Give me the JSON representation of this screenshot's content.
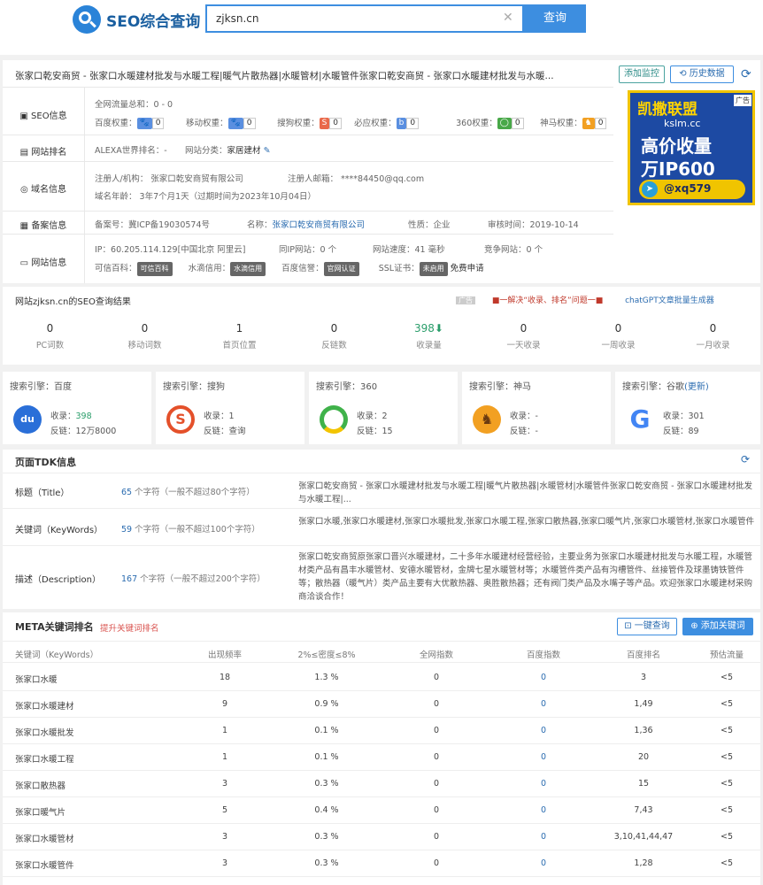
{
  "header": {
    "logo_text": "SEO综合查询",
    "search_value": "zjksn.cn",
    "search_button": "查询"
  },
  "site": {
    "title": "张家口乾安商贸 - 张家口水暖建材批发与水暖工程|暖气片散热器|水暖管材|水暖管件张家口乾安商贸 - 张家口水暖建材批发与水暖...",
    "add_monitor": "添加监控",
    "history": "历史数据",
    "rows": {
      "seo": {
        "label": "SEO信息",
        "total": "全网流量总和：0 - 0",
        "weights": [
          {
            "name": "百度权重：",
            "value": "0",
            "color": "#5a8fe0"
          },
          {
            "name": "移动权重：",
            "value": "0",
            "color": "#5a8fe0"
          },
          {
            "name": "搜狗权重：",
            "value": "0",
            "color": "#e9694a"
          },
          {
            "name": "必应权重：",
            "value": "0",
            "color": "#5a8fe0"
          },
          {
            "name": "360权重：",
            "value": "0",
            "color": "#48a848"
          },
          {
            "name": "神马权重：",
            "value": "0",
            "color": "#f2a022"
          }
        ]
      },
      "rank": {
        "label": "网站排名",
        "alexa": "ALEXA世界排名：-",
        "category_label": "网站分类：",
        "category_value": "家居建材"
      },
      "domain": {
        "label": "域名信息",
        "registrant": "注册人/机构：  张家口乾安商贸有限公司",
        "email": "注册人邮箱：  ****84450@qq.com",
        "age": "域名年龄：  3年7个月1天（过期时间为2023年10月04日）"
      },
      "icp": {
        "label": "备案信息",
        "number": "备案号：冀ICP备19030574号",
        "name_label": "名称：",
        "name_value": "张家口乾安商贸有限公司",
        "nature": "性质：企业",
        "date": "审核时间：2019-10-14"
      },
      "website": {
        "label": "网站信息",
        "ip": "IP：60.205.114.129[中国北京 阿里云]",
        "same_ip": "同IP网站：0 个",
        "speed": "网站速度：41 毫秒",
        "competitors": "竞争网站：0 个",
        "trust_label": "可信百科：",
        "trust_badge": "可信百科",
        "water_label": "水滴信用：",
        "water_badge": "水滴信用",
        "baidu_label": "百度信誉：",
        "baidu_badge": "官网认证",
        "ssl_label": "SSL证书：",
        "ssl_badge": "未启用",
        "ssl_apply": "免费申请"
      }
    }
  },
  "ad": {
    "brand": "凯撒联盟",
    "tag": "广告",
    "domain": "kslm.cc",
    "line1": "高价收量",
    "line2": "万IP600",
    "contact": "@xq579"
  },
  "results": {
    "title": "网站zjksn.cn的SEO查询结果",
    "tag": "广告",
    "promo1": "■一解决“收录、排名”问题一■",
    "promo2": "chatGPT文章批量生成器",
    "stats": [
      {
        "value": "0",
        "label": "PC词数"
      },
      {
        "value": "0",
        "label": "移动词数"
      },
      {
        "value": "1",
        "label": "首页位置"
      },
      {
        "value": "0",
        "label": "反链数"
      },
      {
        "value": "398⬇",
        "label": "收录量"
      },
      {
        "value": "0",
        "label": "一天收录"
      },
      {
        "value": "0",
        "label": "一周收录"
      },
      {
        "value": "0",
        "label": "一月收录"
      }
    ]
  },
  "engines": [
    {
      "title": "搜索引擎：百度",
      "index_label": "收录：",
      "index_value": "398",
      "links_label": "反链：",
      "links_value": "12万8000",
      "icon": "baidu-icon"
    },
    {
      "title": "搜索引擎：搜狗",
      "index_label": "收录：",
      "index_value": "1",
      "links_label": "反链：",
      "links_value": "查询",
      "icon": "sogou-icon"
    },
    {
      "title": "搜索引擎：360",
      "index_label": "收录：",
      "index_value": "2",
      "links_label": "反链：",
      "links_value": "15",
      "icon": "360-icon"
    },
    {
      "title": "搜索引擎：神马",
      "index_label": "收录：",
      "index_value": "-",
      "links_label": "反链：",
      "links_value": "-",
      "icon": "shenma-icon"
    },
    {
      "title": "搜索引擎：谷歌",
      "update": "(更新)",
      "index_label": "收录：",
      "index_value": "301",
      "links_label": "反链：",
      "links_value": "89",
      "icon": "google-icon"
    }
  ],
  "tdk": {
    "title": "页面TDK信息",
    "rows": [
      {
        "label": "标题（Title）",
        "count": "65",
        "count_text": " 个字符（一般不超过80个字符）",
        "content": "张家口乾安商贸 - 张家口水暖建材批发与水暖工程|暖气片散热器|水暖管材|水暖管件张家口乾安商贸 - 张家口水暖建材批发与水暖工程|..."
      },
      {
        "label": "关键词（KeyWords）",
        "count": "59",
        "count_text": " 个字符（一般不超过100个字符）",
        "content": "张家口水暖,张家口水暖建材,张家口水暖批发,张家口水暖工程,张家口散热器,张家口暖气片,张家口水暖管材,张家口水暖管件"
      },
      {
        "label": "描述（Description）",
        "count": "167",
        "count_text": " 个字符（一般不超过200个字符）",
        "content": "张家口乾安商贸原张家口晋兴水暖建材，二十多年水暖建材经营经验，主要业务为张家口水暖建材批发与水暖工程，水暖管材类产品有昌丰水暖管材、安德水暖管材，金牌七星水暖管材等；水暖管件类产品有沟槽管件、丝接管件及球墨铸铁管件等；散热器（暖气片）类产品主要有大优散热器、奥胜散热器；还有阀门类产品及水嘴子等产品。欢迎张家口水暖建材采购商洽谈合作！"
      }
    ]
  },
  "meta": {
    "title": "META关键词排名",
    "promote": "提升关键词排名",
    "one_click": "一键查询",
    "add_keyword": "添加关键词",
    "headers": [
      "关键词（KeyWords）",
      "出现频率",
      "2%≤密度≤8%",
      "全网指数",
      "百度指数",
      "百度排名",
      "预估流量"
    ],
    "rows": [
      [
        "张家口水暖",
        "18",
        "1.3 %",
        "0",
        "0",
        "3",
        "<5"
      ],
      [
        "张家口水暖建材",
        "9",
        "0.9 %",
        "0",
        "0",
        "1,49",
        "<5"
      ],
      [
        "张家口水暖批发",
        "1",
        "0.1 %",
        "0",
        "0",
        "1,36",
        "<5"
      ],
      [
        "张家口水暖工程",
        "1",
        "0.1 %",
        "0",
        "0",
        "20",
        "<5"
      ],
      [
        "张家口散热器",
        "3",
        "0.3 %",
        "0",
        "0",
        "15",
        "<5"
      ],
      [
        "张家口暖气片",
        "5",
        "0.4 %",
        "0",
        "0",
        "7,43",
        "<5"
      ],
      [
        "张家口水暖管材",
        "3",
        "0.3 %",
        "0",
        "0",
        "3,10,41,44,47",
        "<5"
      ],
      [
        "张家口水暖管件",
        "3",
        "0.3 %",
        "0",
        "0",
        "1,28",
        "<5"
      ]
    ]
  }
}
